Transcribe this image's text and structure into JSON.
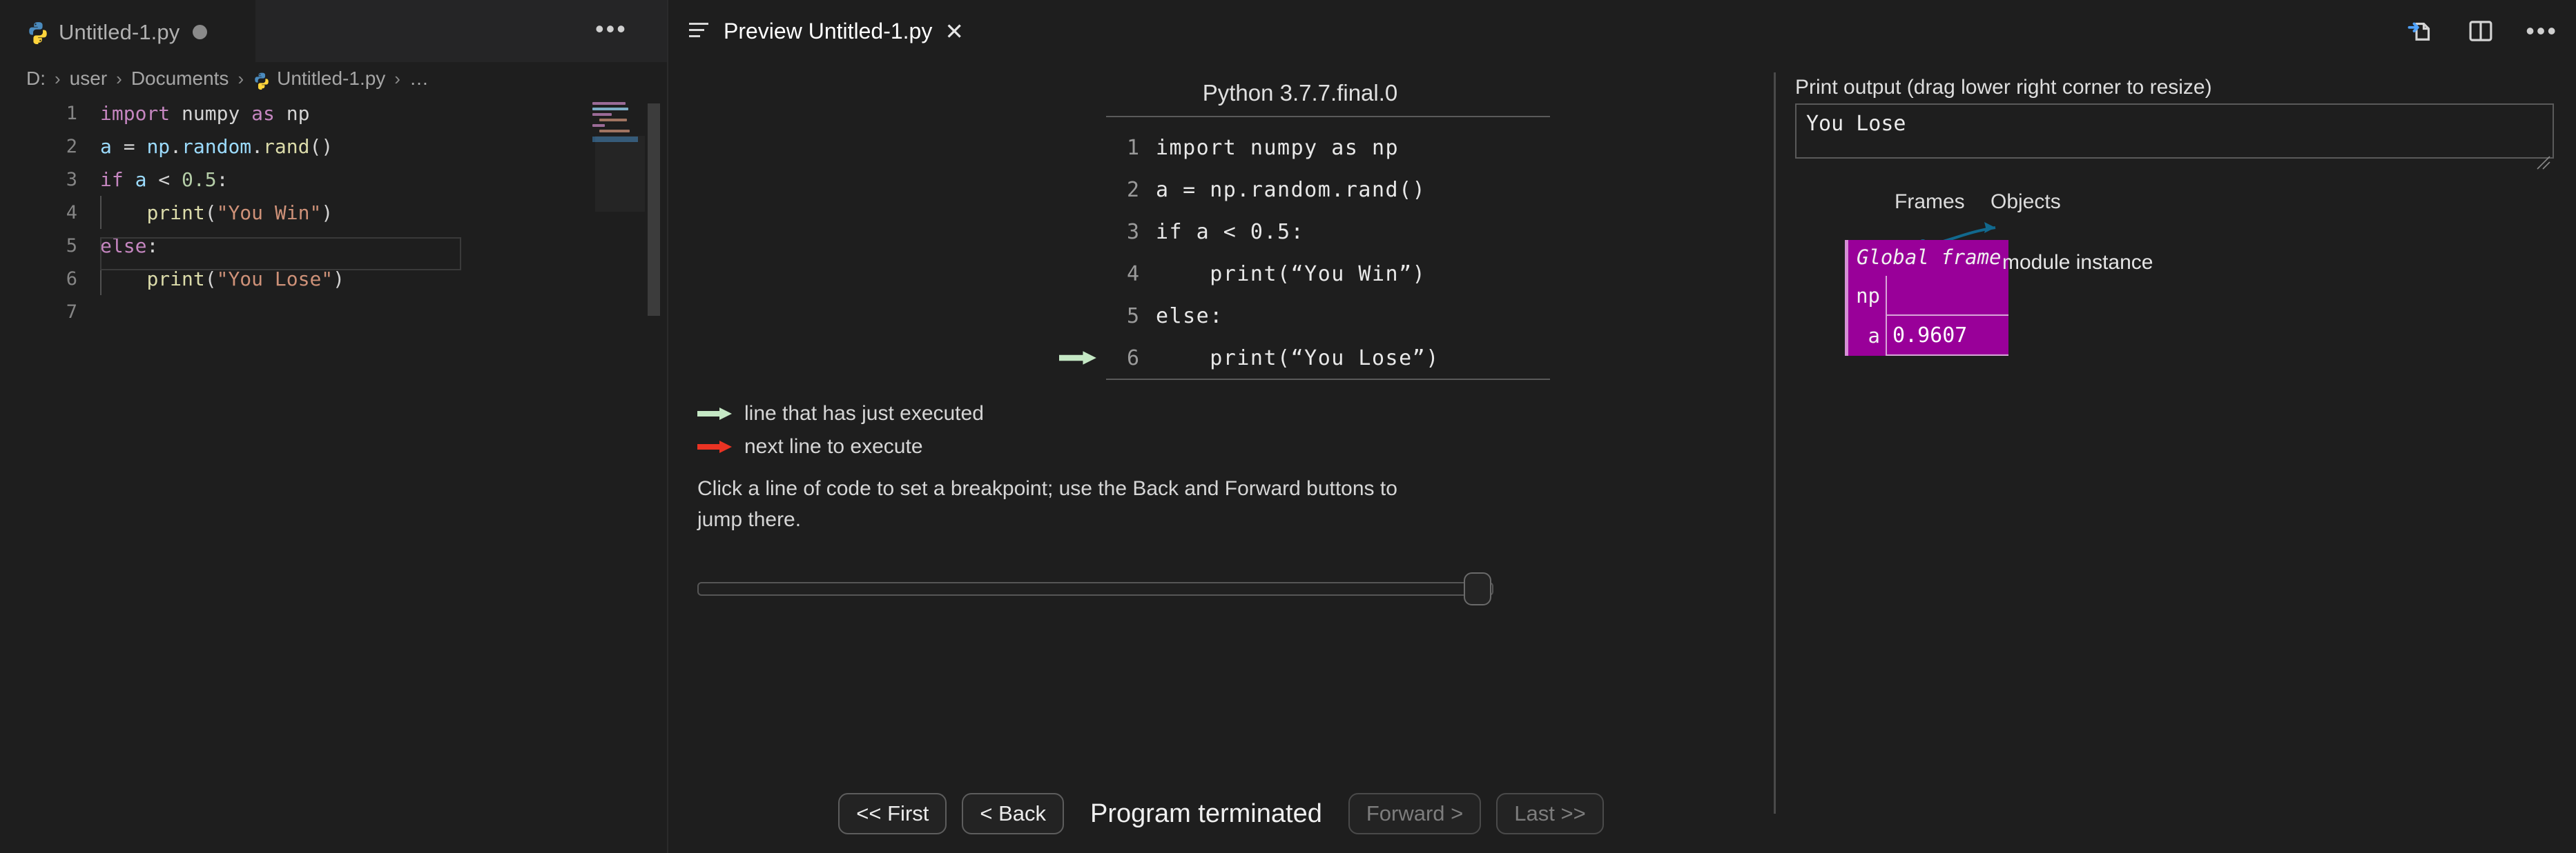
{
  "editor": {
    "tab": {
      "label": "Untitled-1.py",
      "icon": "python-icon",
      "dirty": true
    },
    "overflow_label": "•••",
    "breadcrumb": [
      {
        "label": "D:"
      },
      {
        "label": "user"
      },
      {
        "label": "Documents"
      },
      {
        "label": "Untitled-1.py",
        "icon": "python-icon"
      },
      {
        "label": "…"
      }
    ],
    "breadcrumb_sep": "›",
    "lines": [
      {
        "n": "1",
        "tokens": [
          {
            "t": "import",
            "c": "tok-kw"
          },
          {
            "t": " ",
            "c": "tok-plain"
          },
          {
            "t": "numpy",
            "c": "tok-plain"
          },
          {
            "t": " ",
            "c": "tok-plain"
          },
          {
            "t": "as",
            "c": "tok-kw"
          },
          {
            "t": " ",
            "c": "tok-plain"
          },
          {
            "t": "np",
            "c": "tok-plain"
          }
        ],
        "indent": false
      },
      {
        "n": "2",
        "tokens": [
          {
            "t": "a ",
            "c": "tok-id"
          },
          {
            "t": "= ",
            "c": "tok-op"
          },
          {
            "t": "np",
            "c": "tok-id"
          },
          {
            "t": ".",
            "c": "tok-plain"
          },
          {
            "t": "random",
            "c": "tok-id"
          },
          {
            "t": ".",
            "c": "tok-plain"
          },
          {
            "t": "rand",
            "c": "tok-fn"
          },
          {
            "t": "()",
            "c": "tok-plain"
          }
        ],
        "indent": false
      },
      {
        "n": "3",
        "tokens": [
          {
            "t": "if",
            "c": "tok-kw"
          },
          {
            "t": " ",
            "c": "tok-plain"
          },
          {
            "t": "a",
            "c": "tok-id"
          },
          {
            "t": " < ",
            "c": "tok-op"
          },
          {
            "t": "0.5",
            "c": "tok-num"
          },
          {
            "t": ":",
            "c": "tok-plain"
          }
        ],
        "indent": false
      },
      {
        "n": "4",
        "tokens": [
          {
            "t": "    ",
            "c": "tok-plain"
          },
          {
            "t": "print",
            "c": "tok-fn"
          },
          {
            "t": "(",
            "c": "tok-plain"
          },
          {
            "t": "\"You Win\"",
            "c": "tok-str"
          },
          {
            "t": ")",
            "c": "tok-plain"
          }
        ],
        "indent": true
      },
      {
        "n": "5",
        "tokens": [
          {
            "t": "else",
            "c": "tok-kw"
          },
          {
            "t": ":",
            "c": "tok-plain"
          }
        ],
        "indent": false
      },
      {
        "n": "6",
        "tokens": [
          {
            "t": "    ",
            "c": "tok-plain"
          },
          {
            "t": "print",
            "c": "tok-fn"
          },
          {
            "t": "(",
            "c": "tok-plain"
          },
          {
            "t": "\"You Lose\"",
            "c": "tok-str"
          },
          {
            "t": ")",
            "c": "tok-plain"
          }
        ],
        "indent": true
      },
      {
        "n": "7",
        "tokens": [],
        "indent": false
      }
    ]
  },
  "preview": {
    "tab_label": "Preview Untitled-1.py",
    "tab_icon": "lines-preview-icon",
    "close_label": "✕",
    "actions": [
      {
        "name": "open-preview-to-the-side-icon"
      },
      {
        "name": "split-editor-icon"
      },
      {
        "name": "more-actions-icon",
        "label": "•••"
      }
    ]
  },
  "tutor": {
    "python_version": "Python 3.7.7.final.0",
    "code_lines": [
      {
        "n": "1",
        "text": "import numpy as np",
        "arrow": "none"
      },
      {
        "n": "2",
        "text": "a = np.random.rand()",
        "arrow": "none"
      },
      {
        "n": "3",
        "text": "if a < 0.5:",
        "arrow": "none"
      },
      {
        "n": "4",
        "text": "    print(“You Win”)",
        "arrow": "none"
      },
      {
        "n": "5",
        "text": "else:",
        "arrow": "none"
      },
      {
        "n": "6",
        "text": "    print(“You Lose”)",
        "arrow": "green"
      }
    ],
    "legend": [
      {
        "arrow": "green",
        "text": "line that has just executed"
      },
      {
        "arrow": "red",
        "text": "next line to execute"
      }
    ],
    "hint": "Click a line of code to set a breakpoint; use the Back and Forward buttons to jump there.",
    "nav": {
      "first": "<< First",
      "back": "< Back",
      "status": "Program terminated",
      "forward": "Forward >",
      "last": "Last >>"
    },
    "colors": {
      "green_arrow": "#c5e8c5",
      "red_arrow": "#ea3323",
      "frame_bg": "#990099",
      "pointer": "#11698e"
    }
  },
  "state": {
    "print_output_label": "Print output (drag lower right corner to resize)",
    "print_output_value": "You Lose",
    "frames_header": "Frames",
    "objects_header": "Objects",
    "frame_title": "Global frame",
    "variables": [
      {
        "name": "np",
        "value": ""
      },
      {
        "name": "a",
        "value": "0.9607"
      }
    ],
    "object_label": "module instance"
  }
}
